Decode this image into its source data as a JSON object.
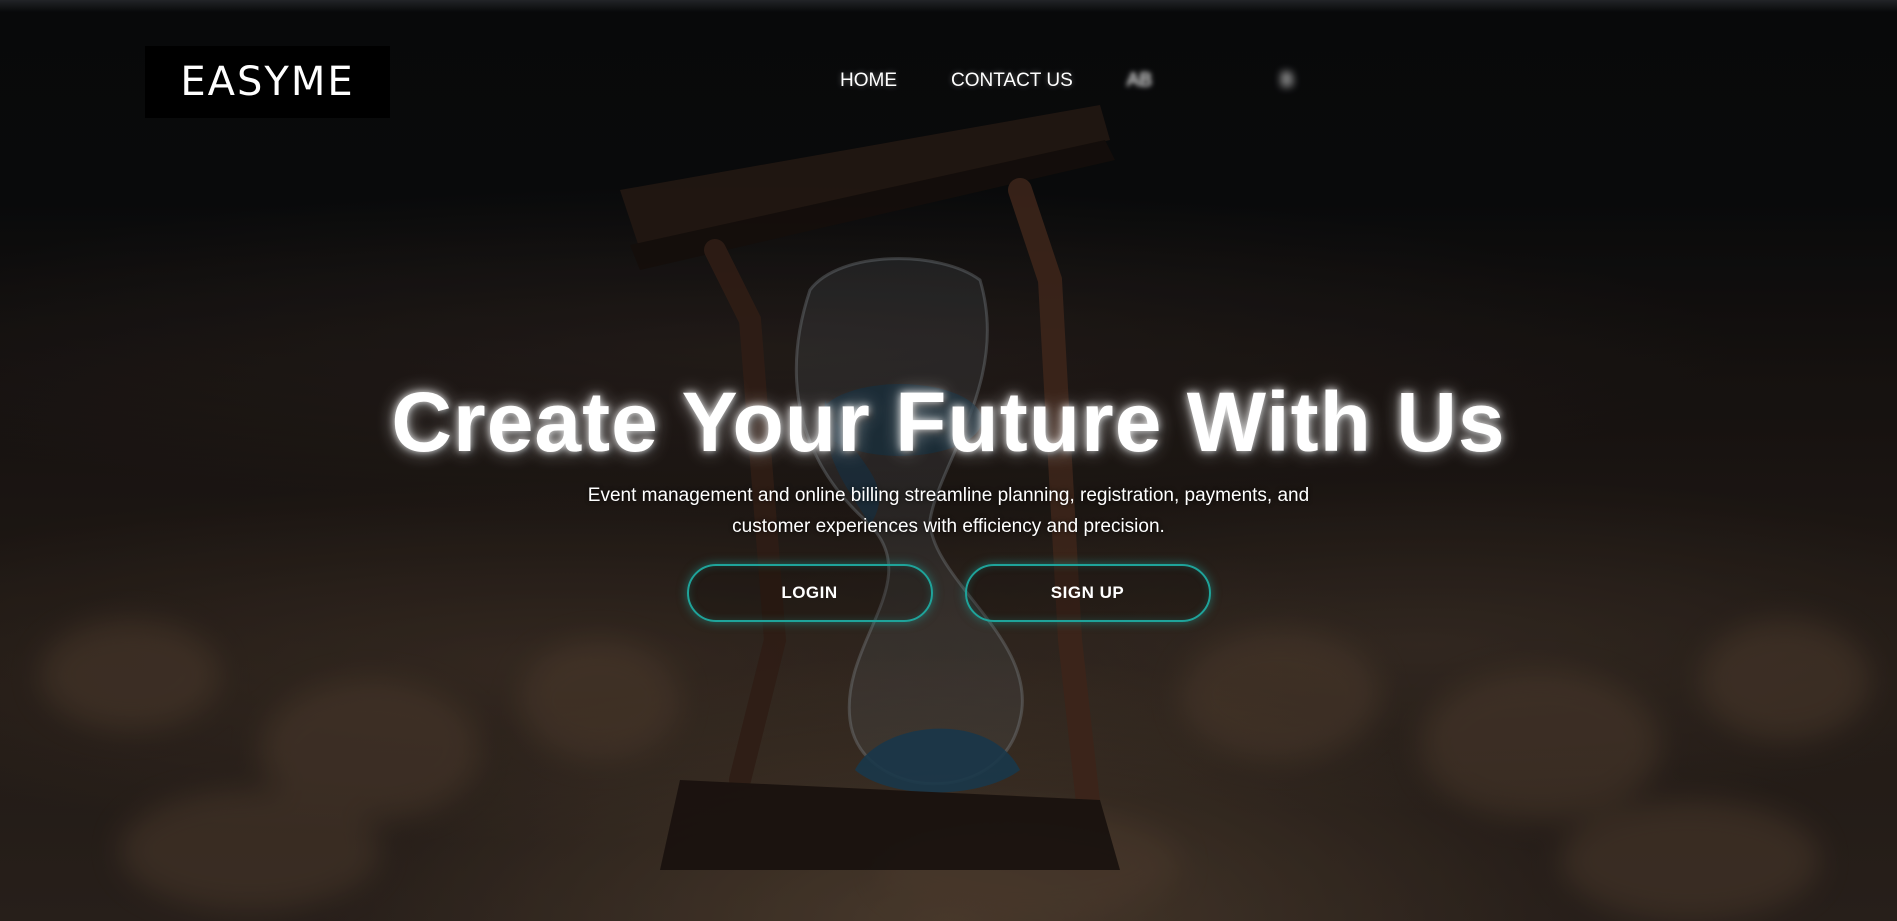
{
  "brand": {
    "logo_text": "EASYME"
  },
  "nav": {
    "items": [
      {
        "label": "HOME"
      },
      {
        "label": "CONTACT US"
      },
      {
        "label": "AB"
      },
      {
        "label": "B"
      },
      {
        "label": ""
      },
      {
        "label": ""
      }
    ]
  },
  "hero": {
    "title": "Create Your Future With Us",
    "subtitle": "Event management and online billing streamline planning, registration, payments, and customer experiences with efficiency and precision.",
    "login_label": "LOGIN",
    "signup_label": "SIGN UP"
  },
  "colors": {
    "accent": "#1fa39a",
    "background": "#0b0b0c",
    "logo_bg": "#000000",
    "text": "#ffffff"
  },
  "icons": {
    "background": "hourglass-image"
  }
}
